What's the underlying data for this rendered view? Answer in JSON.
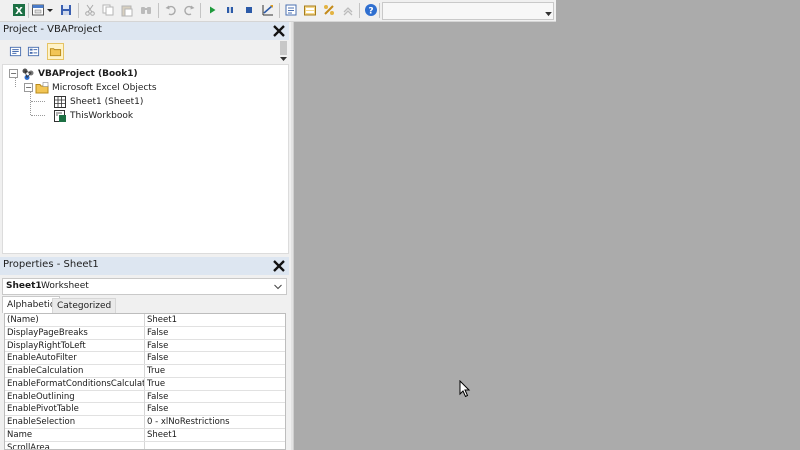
{
  "toolbar": {
    "icons": [
      "excel-view-icon",
      "insert-userform-icon",
      "dropdown-arrow-icon",
      "save-icon",
      "cut-icon",
      "copy-icon",
      "paste-icon",
      "find-icon",
      "undo-icon",
      "redo-icon",
      "run-icon",
      "break-icon",
      "reset-icon",
      "design-mode-icon",
      "project-explorer-icon",
      "properties-window-icon",
      "object-browser-icon",
      "toolbox-icon",
      "help-icon"
    ],
    "combo_value": ""
  },
  "project_pane": {
    "title": "Project - VBAProject",
    "tree": {
      "root": "VBAProject (Book1)",
      "folder": "Microsoft Excel Objects",
      "items": [
        "Sheet1 (Sheet1)",
        "ThisWorkbook"
      ]
    }
  },
  "properties_pane": {
    "title": "Properties - Sheet1",
    "object_name": "Sheet1",
    "object_type": "Worksheet",
    "tabs": [
      "Alphabetic",
      "Categorized"
    ],
    "active_tab": "Alphabetic",
    "rows": [
      {
        "name": "(Name)",
        "value": "Sheet1"
      },
      {
        "name": "DisplayPageBreaks",
        "value": "False"
      },
      {
        "name": "DisplayRightToLeft",
        "value": "False"
      },
      {
        "name": "EnableAutoFilter",
        "value": "False"
      },
      {
        "name": "EnableCalculation",
        "value": "True"
      },
      {
        "name": "EnableFormatConditionsCalculation",
        "value": "True"
      },
      {
        "name": "EnableOutlining",
        "value": "False"
      },
      {
        "name": "EnablePivotTable",
        "value": "False"
      },
      {
        "name": "EnableSelection",
        "value": "0 - xlNoRestrictions"
      },
      {
        "name": "Name",
        "value": "Sheet1"
      },
      {
        "name": "ScrollArea",
        "value": ""
      }
    ]
  },
  "colors": {
    "pane_title_bg": "#dde6f1",
    "workspace_bg": "#ababab",
    "panel_bg": "#f0f0f0",
    "close_x": "#111111"
  }
}
